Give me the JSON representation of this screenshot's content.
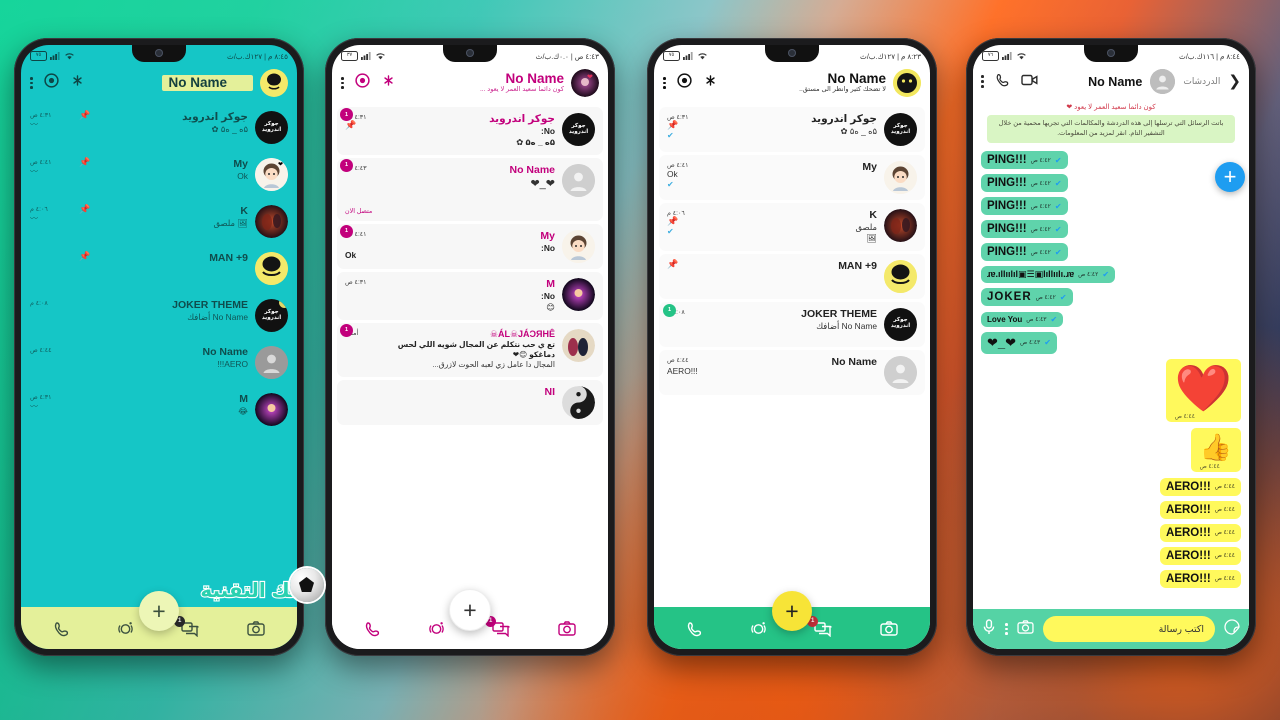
{
  "meta": {
    "watermark": "بنك التقنية",
    "theme_accents": {
      "phone1_bg": "#15c6c6",
      "phone1_accent": "#e4f09a",
      "phone2_accent": "#c2007c",
      "phone3_accent": "#25c386",
      "phone4_accent": "#55d3a5",
      "phone4_bubble_in": "#5fd3ab",
      "phone4_bubble_out": "#fff95c"
    }
  },
  "phone1": {
    "statusbar": {
      "battery": "٧٥",
      "right": "٨:٤٥ م | ١٢٧ك.ب/ث"
    },
    "appbar": {
      "title": "No Name",
      "subtitle": "",
      "menu_icon": "overflow-menu-icon",
      "status_icon": "status-ring-icon",
      "broadcast_icon": "broadcast-icon",
      "avatar_label": "joker"
    },
    "rows": [
      {
        "name": "جوكر اندرويد",
        "msg": "۵ه _ ه۵ ✿",
        "time": "٤:٣١ ص",
        "pin": true,
        "mute": true,
        "badge": "",
        "avatar": "joker-android",
        "avatar_label": "جوكر\nاندرويد"
      },
      {
        "name": "My",
        "msg": "Ok",
        "time": "٤:٤١ ص",
        "pin": true,
        "mute": true,
        "badge": "",
        "avatar": "girl-chibi",
        "avatar_label": ""
      },
      {
        "name": "K",
        "msg": "🖼 ملصق",
        "time": "٤:٠٦ م",
        "pin": true,
        "mute": true,
        "badge": "",
        "avatar": "dark-photo",
        "avatar_label": ""
      },
      {
        "name": "MAN +9",
        "msg": "",
        "time": "",
        "pin": true,
        "mute": false,
        "badge": "",
        "avatar": "yellow-joker",
        "avatar_label": ""
      },
      {
        "name": "JOKER THEME",
        "msg": "No Name أضافك",
        "time": "٤:٠٨ م",
        "pin": false,
        "mute": false,
        "badge": "1",
        "avatar": "joker-android",
        "avatar_label": "جوكر\nاندرويد"
      },
      {
        "name": "No Name",
        "msg": "AERO!!!",
        "time": "٤:٤٤ ص",
        "pin": false,
        "mute": false,
        "badge": "",
        "avatar": "default-person",
        "avatar_label": ""
      },
      {
        "name": "M",
        "msg": "😂",
        "time": "٤:٣١ ص",
        "pin": false,
        "mute": true,
        "badge": "",
        "avatar": "galaxy-photo",
        "avatar_label": ""
      }
    ],
    "bottomnav": {
      "calls": "phone-icon",
      "status": "status-icon",
      "chats": "chats-icon",
      "camera": "camera-icon",
      "chats_badge": "1",
      "fab": "+"
    }
  },
  "phone2": {
    "statusbar": {
      "battery": "٣٧",
      "right": "٤:٤٣ ص | ٠.٠ك.ب/ث"
    },
    "appbar": {
      "title": "No Name",
      "subtitle": "كون دائما سعيد العمر لا يعود ...",
      "menu_icon": "overflow-menu-icon",
      "status_icon": "status-ring-icon",
      "broadcast_icon": "broadcast-icon",
      "avatar_label": "pink"
    },
    "rows": [
      {
        "name": "جوكر اندرويد",
        "msg": "No:",
        "msg2": "۵ه _ ه۵ ✿",
        "time": "٤:٣١ ص",
        "pin": true,
        "badge": "1",
        "avatar": "joker-android",
        "avatar_label": "جوكر\nاندرويد",
        "online": ""
      },
      {
        "name": "No Name",
        "msg": "❤_❤",
        "time": "٤:٤٣ ص",
        "pin": false,
        "badge": "1",
        "avatar": "default-person",
        "avatar_label": "",
        "online": "متصل الان"
      },
      {
        "name": "My",
        "msg": "No:",
        "msg2": "Ok",
        "time": "٤:٤١ ص",
        "pin": false,
        "badge": "1",
        "avatar": "girl-chibi",
        "avatar_label": "",
        "online": ""
      },
      {
        "name": "M",
        "msg": "No:",
        "msg2": "😊",
        "time": "٤:٣١ ص",
        "pin": false,
        "badge": "",
        "avatar": "galaxy-photo",
        "avatar_label": "",
        "online": ""
      },
      {
        "name": "ÁL☠JÁƆЯHÊ☠",
        "msg": "تع ي حب نتكلم عن المجال شويه اللي لحس دماغكو 😊❤",
        "msg2": "المجال دا عامل زي لعبه الحوت لازرق...",
        "time": "أمس",
        "pin": false,
        "badge": "1",
        "avatar": "couple-photo",
        "avatar_label": "",
        "online": ""
      },
      {
        "name": "NI",
        "msg": "",
        "time": "",
        "pin": false,
        "badge": "",
        "avatar": "yinyang-photo",
        "avatar_label": "",
        "online": ""
      }
    ],
    "bottomnav": {
      "calls": "phone-icon",
      "status": "status-icon",
      "chats": "chats-icon",
      "camera": "camera-icon",
      "chats_badge": "1",
      "fab": "+"
    }
  },
  "phone3": {
    "statusbar": {
      "battery": "٧٥",
      "right": "٨:٢٣ م | ١٢٧ك.ب/ث"
    },
    "appbar": {
      "title": "No Name",
      "subtitle": "لا تضحك كثير وانظر الى مستق..",
      "menu_icon": "overflow-menu-icon",
      "status_icon": "status-ring-icon",
      "broadcast_icon": "broadcast-icon",
      "avatar_label": "yellow"
    },
    "rows": [
      {
        "name": "جوكر اندرويد",
        "msg": "۵ه _ ه۵ ✿",
        "time": "٤:٣١ ص",
        "pin": true,
        "tick": true,
        "badge": "",
        "avatar": "joker-android",
        "avatar_label": "جوكر\nاندرويد"
      },
      {
        "name": "My",
        "msg": "Ok",
        "time": "٤:٤١ ص",
        "pin": true,
        "tick": true,
        "badge": "",
        "avatar": "girl-chibi",
        "avatar_label": ""
      },
      {
        "name": "K",
        "msg": "ملصق",
        "msg2": "🖼",
        "time": "٤:٠٦ م",
        "pin": true,
        "tick": true,
        "badge": "",
        "avatar": "dark-photo",
        "avatar_label": ""
      },
      {
        "name": "MAN +9",
        "msg": "",
        "time": "",
        "pin": true,
        "tick": false,
        "badge": "",
        "avatar": "yellow-joker",
        "avatar_label": ""
      },
      {
        "name": "JOKER THEME",
        "msg": "No Name أضافك",
        "time": "٤:٠٨ م",
        "pin": false,
        "tick": false,
        "badge": "1",
        "avatar": "joker-android",
        "avatar_label": "جوكر\nاندرويد"
      },
      {
        "name": "No Name",
        "msg": "AERO!!!",
        "time": "٤:٤٤ ص",
        "pin": false,
        "tick": false,
        "badge": "",
        "avatar": "default-person",
        "avatar_label": ""
      }
    ],
    "bottomnav": {
      "calls": "phone-icon",
      "status": "status-icon",
      "chats": "chats-icon",
      "camera": "camera-icon",
      "chats_badge": "1",
      "fab": "+"
    }
  },
  "phone4": {
    "statusbar": {
      "battery": "٧٦",
      "right": "٨:٤٤ م | ١١٦ك.ب/ث"
    },
    "convbar": {
      "back_icon": "back-chevron-icon",
      "chats_label": "الدردشات",
      "avatar_icon": "default-person",
      "name": "No Name",
      "video_icon": "video-call-icon",
      "call_icon": "voice-call-icon",
      "menu_icon": "overflow-menu-icon"
    },
    "status_line": "كون دائما سعيد العمر لا يعود ❤",
    "encryption_notice": "باتت الرسائل التي ترسلها إلى هذه الدردشة والمكالمات التي تجريها محمية من خلال التشفير التام. انقر لمزيد من المعلومات.",
    "float_button": "+",
    "messages": [
      {
        "side": "in",
        "text": "PING!!!",
        "time": "٤:٤٢ ص",
        "tick": "✔"
      },
      {
        "side": "in",
        "text": "PING!!!",
        "time": "٤:٤٢ ص",
        "tick": "✔"
      },
      {
        "side": "in",
        "text": "PING!!!",
        "time": "٤:٤٢ ص",
        "tick": "✔"
      },
      {
        "side": "in",
        "text": "PING!!!",
        "time": "٤:٤٢ ص",
        "tick": "✔"
      },
      {
        "side": "in",
        "text": "PING!!!",
        "time": "٤:٤٢ ص",
        "tick": "✔"
      },
      {
        "side": "in",
        "text": "ɹɐ.ıllıılıl▣☰▣lıllıılı.ɹɐ",
        "time": "٤:٤٢ ص",
        "tick": "✔"
      },
      {
        "side": "in",
        "text": "JOKER",
        "time": "٤:٤٢ ص",
        "tick": "✔"
      },
      {
        "side": "in",
        "text": "Love You",
        "time": "٤:٤٣ ص",
        "tick": "✔"
      },
      {
        "side": "in",
        "text": "❤_❤",
        "time": "٤:٤٣ ص",
        "tick": "✔"
      }
    ],
    "out_big": [
      {
        "emoji": "❤️",
        "time": "٤:٤٤ ص",
        "size": "big"
      },
      {
        "emoji": "👍",
        "time": "٤:٤٤ ص",
        "size": "small"
      }
    ],
    "out_texts": [
      {
        "text": "AERO!!!",
        "time": "٤:٤٤ ص"
      },
      {
        "text": "AERO!!!",
        "time": "٤:٤٤ ص"
      },
      {
        "text": "AERO!!!",
        "time": "٤:٤٤ ص"
      },
      {
        "text": "AERO!!!",
        "time": "٤:٤٤ ص"
      },
      {
        "text": "AERO!!!",
        "time": "٤:٤٤ ص"
      }
    ],
    "composer": {
      "placeholder": "اكتب رسالة",
      "sticker_icon": "sticker-icon",
      "camera_icon": "camera-icon",
      "attach_icon": "attach-icon",
      "mic_icon": "microphone-icon"
    }
  }
}
